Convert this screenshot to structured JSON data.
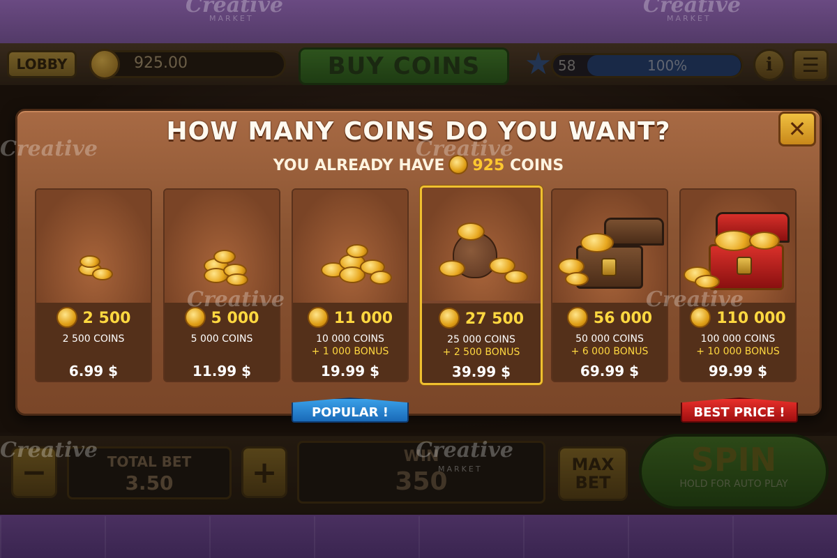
{
  "hud": {
    "lobby_label": "LOBBY",
    "balance": "925.00",
    "buy_label": "BUY COINS",
    "level": "58",
    "level_progress": "100%",
    "info_label": "i",
    "menu_label": "☰"
  },
  "bottom": {
    "minus_label": "−",
    "total_bet_label": "TOTAL BET",
    "total_bet_value": "3.50",
    "plus_label": "+",
    "win_label": "WIN",
    "win_value": "350",
    "max_bet_label": "MAX BET",
    "spin_label": "SPIN",
    "spin_sub": "HOLD FOR AUTO PLAY"
  },
  "modal": {
    "title": "HOW MANY COINS DO YOU WANT?",
    "close_label": "✕",
    "have_prefix": "YOU ALREADY HAVE",
    "have_amount": "925",
    "have_suffix": "COINS"
  },
  "packages": [
    {
      "amount": "2 500",
      "coins": "2 500 COINS",
      "bonus": "",
      "price": "6.99 $"
    },
    {
      "amount": "5 000",
      "coins": "5 000 COINS",
      "bonus": "",
      "price": "11.99 $"
    },
    {
      "amount": "11 000",
      "coins": "10 000 COINS",
      "bonus": "+ 1 000 BONUS",
      "price": "19.99 $"
    },
    {
      "amount": "27 500",
      "coins": "25 000 COINS",
      "bonus": "+ 2 500 BONUS",
      "price": "39.99 $"
    },
    {
      "amount": "56 000",
      "coins": "50 000 COINS",
      "bonus": "+ 6 000 BONUS",
      "price": "69.99 $"
    },
    {
      "amount": "110 000",
      "coins": "100 000 COINS",
      "bonus": "+ 10 000 BONUS",
      "price": "99.99 $"
    }
  ],
  "ribbons": {
    "popular": "POPULAR !",
    "best": "BEST PRICE !"
  },
  "watermark": {
    "brand": "Creative",
    "sub": "MARKET"
  },
  "colors": {
    "accent_gold": "#ffd840",
    "modal_bg": "#8a5432",
    "popular_blue": "#1a6ab8",
    "best_red": "#a01010"
  }
}
